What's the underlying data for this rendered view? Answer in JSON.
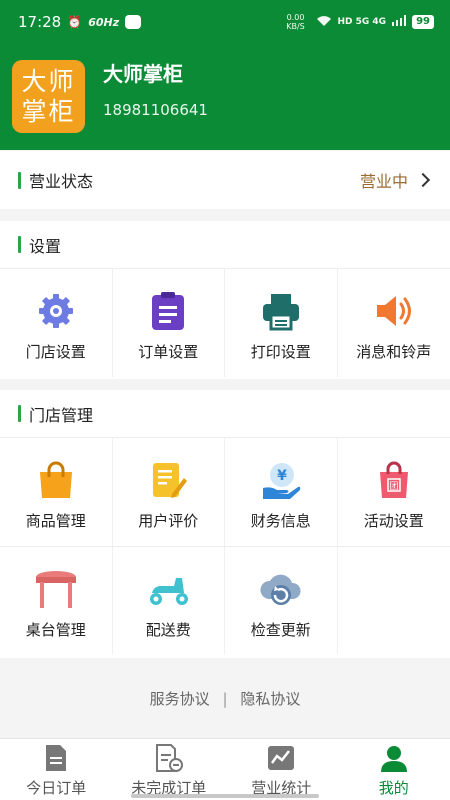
{
  "status_bar": {
    "time": "17:28",
    "refresh_rate": "60Hz",
    "net_speed": "0.00 KB/S",
    "network": "HD 5G 4G",
    "battery": "99"
  },
  "header": {
    "avatar_text": "大师掌柜",
    "store_name": "大师掌柜",
    "phone": "18981106641"
  },
  "business_status": {
    "label": "营业状态",
    "value": "营业中"
  },
  "settings": {
    "title": "设置",
    "items": [
      {
        "label": "门店设置",
        "icon": "gear-icon",
        "color": "#6d7be3"
      },
      {
        "label": "订单设置",
        "icon": "clipboard-icon",
        "color": "#6a3fc4"
      },
      {
        "label": "打印设置",
        "icon": "printer-icon",
        "color": "#1f6e6a"
      },
      {
        "label": "消息和铃声",
        "icon": "speaker-icon",
        "color": "#f07830"
      }
    ]
  },
  "store_management": {
    "title": "门店管理",
    "items": [
      {
        "label": "商品管理",
        "icon": "shopping-bag-icon",
        "color": "#f7a21b"
      },
      {
        "label": "用户评价",
        "icon": "review-pencil-icon",
        "color": "#f5c22c"
      },
      {
        "label": "财务信息",
        "icon": "yen-hand-icon",
        "color": "#2f86d8"
      },
      {
        "label": "活动设置",
        "icon": "promo-bag-icon",
        "color": "#ef5a6e"
      },
      {
        "label": "桌台管理",
        "icon": "table-icon",
        "color": "#ea7b7b"
      },
      {
        "label": "配送费",
        "icon": "scooter-icon",
        "color": "#3fc1cf"
      },
      {
        "label": "检查更新",
        "icon": "cloud-refresh-icon",
        "color": "#5b7fa8"
      }
    ]
  },
  "footer_links": {
    "service": "服务协议",
    "separator": "|",
    "privacy": "隐私协议"
  },
  "tabs": [
    {
      "label": "今日订单",
      "icon": "document-icon",
      "active": false
    },
    {
      "label": "未完成订单",
      "icon": "pending-document-icon",
      "active": false
    },
    {
      "label": "营业统计",
      "icon": "stats-chart-icon",
      "active": false
    },
    {
      "label": "我的",
      "icon": "person-icon",
      "active": true
    }
  ],
  "colors": {
    "brand_green": "#0b8b36",
    "status_brown": "#9a6a33",
    "accent_bar": "#2fa24a"
  }
}
